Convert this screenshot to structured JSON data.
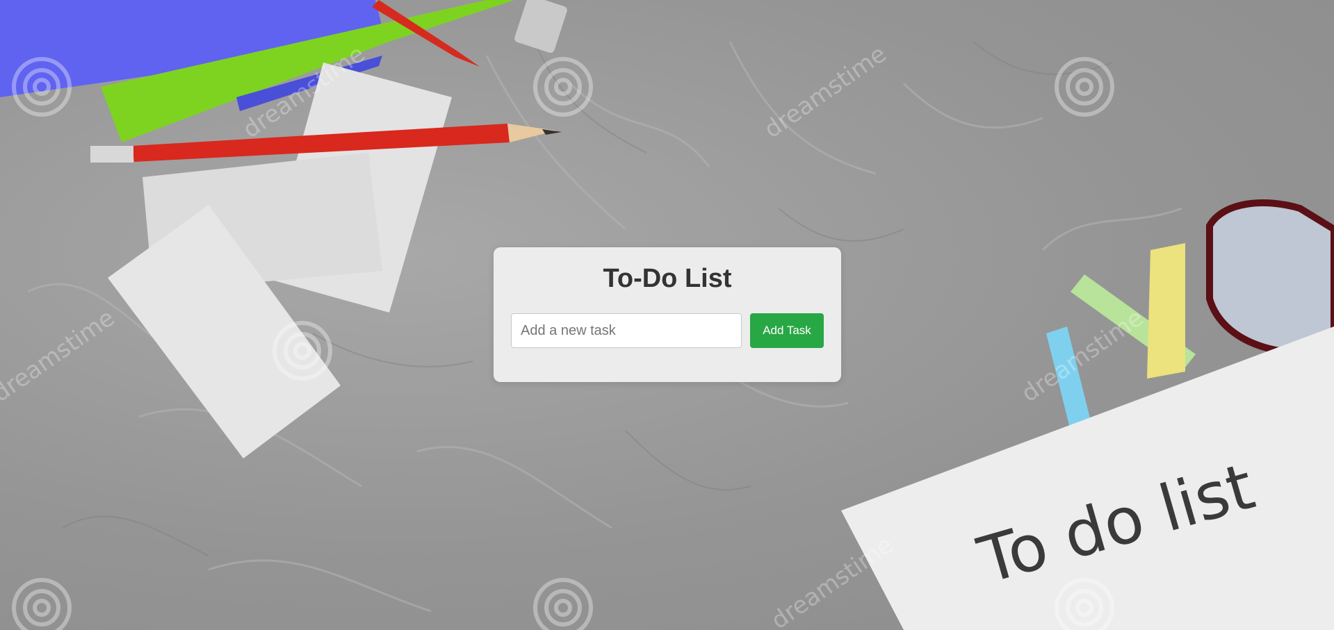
{
  "app": {
    "title": "To-Do List"
  },
  "form": {
    "input_placeholder": "Add a new task",
    "input_value": "",
    "add_button_label": "Add Task"
  },
  "background": {
    "note_text": "To do list",
    "watermark_text": "dreamstime"
  },
  "colors": {
    "accent": "#28a745",
    "card": "#ececec",
    "title": "#333333"
  }
}
